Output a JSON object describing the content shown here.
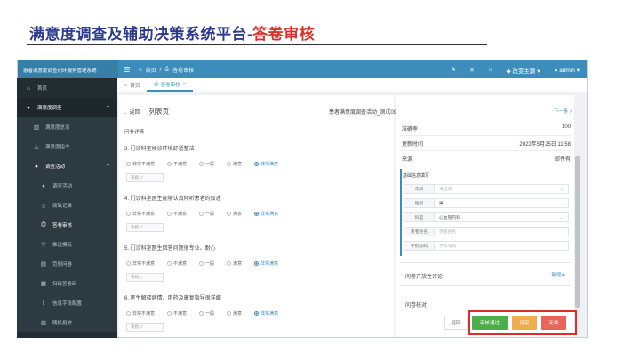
{
  "slide": {
    "title_main": "满意度调查及辅助决策系统平台-",
    "title_highlight": "答卷审核"
  },
  "topbar": {
    "brand": "患者满意度调查闭环服务管理系统",
    "menu_icon": "☰",
    "breadcrumb_home": "首页",
    "breadcrumb_current": "答卷审核",
    "font_icon": "A",
    "expand_icon": "✕",
    "theme_label": "改变主题",
    "user_label": "admin"
  },
  "sidebar": {
    "items": [
      {
        "label": "首页",
        "icon": "home-icon"
      },
      {
        "label": "满意度调查",
        "icon": "user-icon"
      },
      {
        "label": "满意度总览",
        "icon": "chart-icon"
      },
      {
        "label": "满意度指令",
        "icon": "triangle-icon"
      },
      {
        "label": "调查活动",
        "icon": "user-icon"
      },
      {
        "label": "调查活动",
        "icon": "user-icon"
      },
      {
        "label": "拨致记录",
        "icon": "bookmark-icon"
      },
      {
        "label": "答卷审核",
        "icon": "printer-icon"
      },
      {
        "label": "推送模板",
        "icon": "funnel-icon"
      },
      {
        "label": "范例问卷",
        "icon": "file-icon"
      },
      {
        "label": "扫码答卷码",
        "icon": "grid-icon"
      },
      {
        "label": "信息字段配置",
        "icon": "info-icon"
      },
      {
        "label": "随机投放",
        "icon": "chart-icon"
      }
    ]
  },
  "tabs": [
    {
      "label": "首页"
    },
    {
      "label": "答卷审核"
    }
  ],
  "subhead": {
    "back": "← 返回",
    "title": "列表页",
    "survey_name": "患者满意度调查活动_测试09",
    "next": "下一条 >"
  },
  "left": {
    "section": "问卷详情",
    "questions": [
      {
        "title": "3. 门诊科室候诊环境舒适整洁",
        "options": [
          "非常不满意",
          "不满意",
          "一般",
          "满意",
          "非常满意"
        ],
        "selected": 4,
        "remark": "表扬 ▽"
      },
      {
        "title": "4. 门诊科室医生能够认真倾听患者的叙述",
        "options": [
          "非常不满意",
          "不满意",
          "一般",
          "满意",
          "非常满意"
        ],
        "selected": 4,
        "remark": "表扬 ▽"
      },
      {
        "title": "5. 门诊科室医生回答问题很专业、耐心",
        "options": [
          "非常不满意",
          "不满意",
          "一般",
          "满意",
          "非常满意"
        ],
        "selected": 4,
        "remark": "表扬 ▽"
      },
      {
        "title": "6. 医生解释病情、用药及康复指导很详细",
        "options": [
          "非常不满意",
          "不满意",
          "一般",
          "满意",
          "非常满意"
        ],
        "selected": 4,
        "remark": "表扬 ▽"
      }
    ]
  },
  "right": {
    "accuracy_label": "准确率",
    "accuracy_value": "100",
    "update_label": "更新时间",
    "update_value": "2022年5月25日 11:58",
    "source_label": "来源",
    "source_value": "邮件有",
    "basic_info": "基础信息填写",
    "fields": [
      {
        "label": "年龄",
        "value": "请选择",
        "placeholder": true,
        "chevron": true
      },
      {
        "label": "性别",
        "value": "男",
        "placeholder": false,
        "chevron": true
      },
      {
        "label": "科室",
        "value": "心血管内科",
        "placeholder": false,
        "chevron": true
      },
      {
        "label": "患者姓名",
        "value": "患者姓名",
        "placeholder": true,
        "chevron": false
      },
      {
        "label": "手机号码",
        "value": "手机号码",
        "placeholder": true,
        "chevron": false
      }
    ],
    "comments_label": "问卷开放性评论",
    "comments_add": "新增⊕",
    "review_label": "问卷核对"
  },
  "buttons": {
    "back": "返回",
    "pass": "审核通过",
    "pending": "待定",
    "invalid": "无效"
  },
  "colors": {
    "title_blue": "#2b3a8c",
    "title_red": "#d6332a",
    "topbar": "#3c8dbc",
    "sidebar": "#222d32",
    "pass": "#4cae4c",
    "pending": "#f0ad4e",
    "invalid": "#e9645a",
    "highlight_box": "#e02b2b"
  }
}
